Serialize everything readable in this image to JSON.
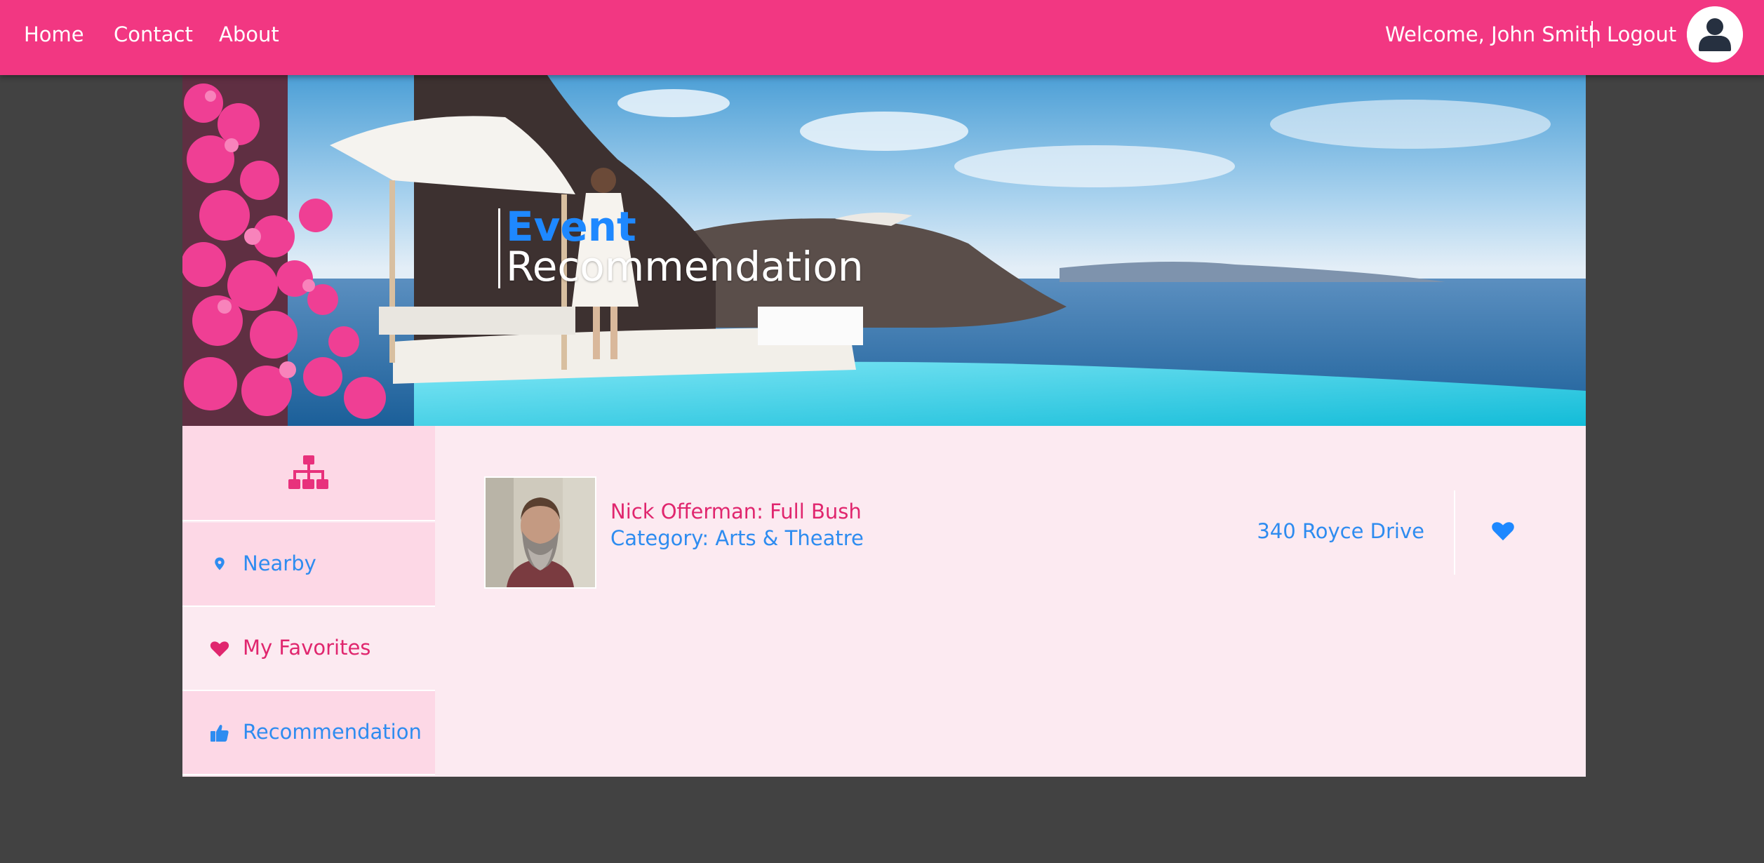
{
  "nav": {
    "links": [
      {
        "label": "Home"
      },
      {
        "label": "Contact"
      },
      {
        "label": "About"
      }
    ],
    "welcome": "Welcome, John Smith",
    "logout": "Logout",
    "avatar_icon": "user-avatar-icon"
  },
  "hero": {
    "title_line1": "Event",
    "title_line2": "Recommendation"
  },
  "sidebar": {
    "top_icon": "sitemap-icon",
    "items": [
      {
        "label": "Nearby",
        "icon": "map-marker-icon",
        "color": "#2e8cf0"
      },
      {
        "label": "My Favorites",
        "icon": "heart-icon",
        "color": "#e0266e"
      },
      {
        "label": "Recommendation",
        "icon": "thumbs-up-icon",
        "color": "#2e8cf0"
      }
    ]
  },
  "events": [
    {
      "title": "Nick Offerman: Full Bush",
      "category": "Category: Arts & Theatre",
      "address": "340 Royce Drive",
      "favorite_icon": "heart-icon"
    }
  ],
  "colors": {
    "brand_pink": "#f23782",
    "accent_blue": "#1e88ff",
    "background": "#424242"
  }
}
